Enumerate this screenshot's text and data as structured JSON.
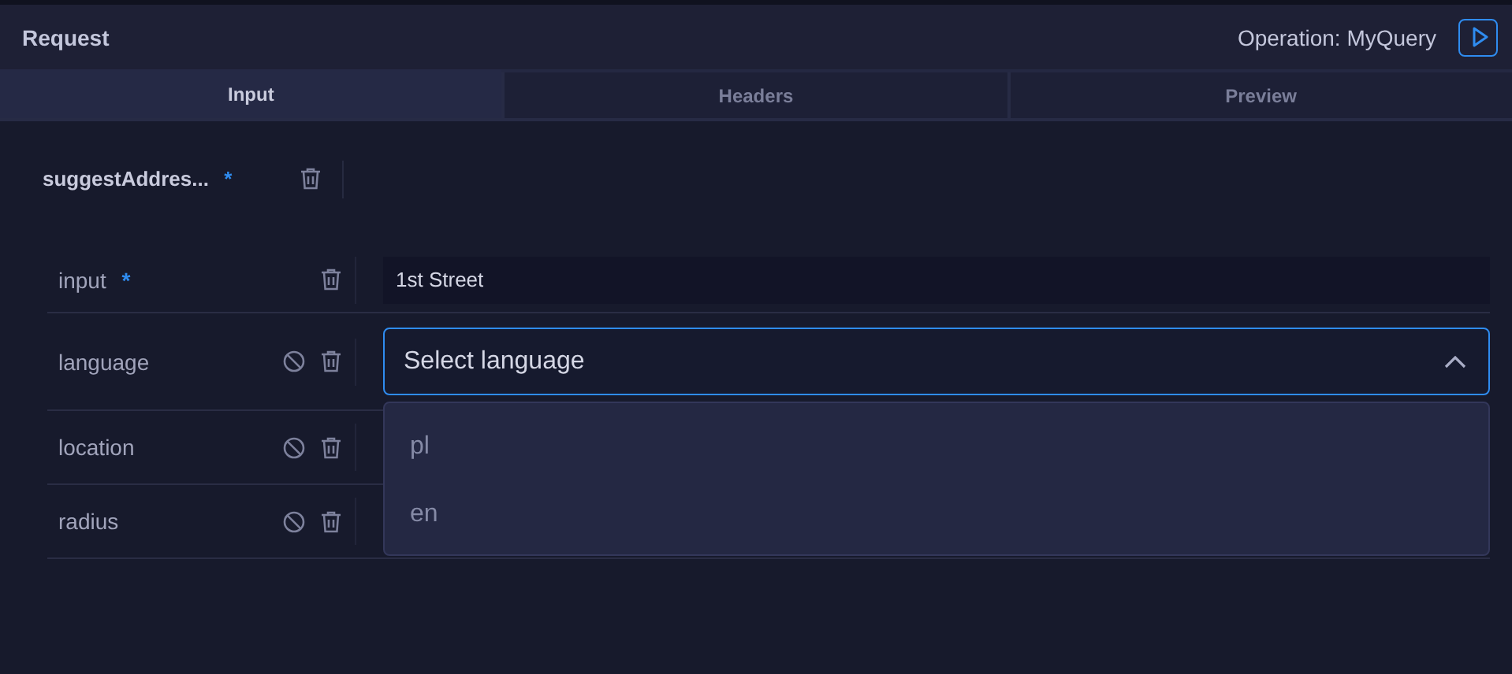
{
  "header": {
    "title": "Request",
    "operation": "Operation: MyQuery"
  },
  "tabs": [
    {
      "label": "Input",
      "selected": true
    },
    {
      "label": "Headers",
      "selected": false
    },
    {
      "label": "Preview",
      "selected": false
    }
  ],
  "field": {
    "name": "suggestAddres...",
    "required": true,
    "required_mark": "*"
  },
  "args": [
    {
      "name": "input",
      "required": true,
      "required_mark": "*",
      "nullable": false,
      "kind": "text",
      "value": "1st Street"
    },
    {
      "name": "language",
      "required": false,
      "nullable": true,
      "kind": "select",
      "placeholder": "Select language",
      "expanded": true,
      "options": [
        "pl",
        "en"
      ]
    },
    {
      "name": "location",
      "required": false,
      "nullable": true,
      "kind": "none"
    },
    {
      "name": "radius",
      "required": false,
      "nullable": true,
      "kind": "none"
    }
  ]
}
